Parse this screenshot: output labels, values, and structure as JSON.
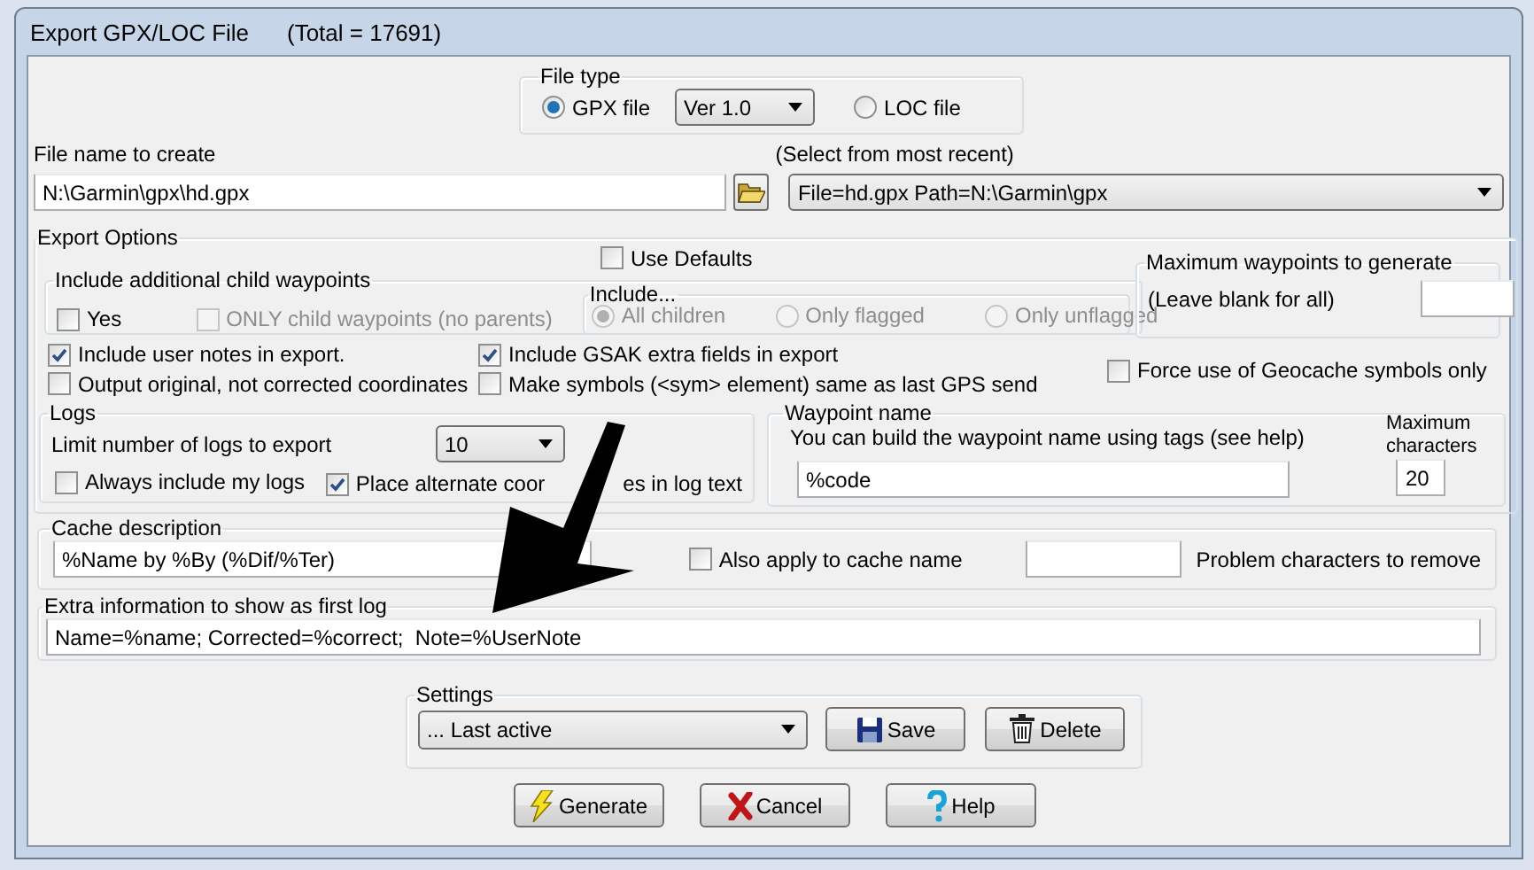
{
  "window": {
    "title": "Export GPX/LOC File",
    "total": "(Total = 17691)"
  },
  "file_type": {
    "label": "File type",
    "version": "Ver 1.0",
    "options": [
      {
        "label": "GPX file",
        "selected": true
      },
      {
        "label": "LOC file",
        "selected": false
      }
    ]
  },
  "file_name": {
    "label": "File name to create",
    "value": "N:\\Garmin\\gpx\\hd.gpx"
  },
  "recent": {
    "label": "(Select from most recent)",
    "value": "File=hd.gpx Path=N:\\Garmin\\gpx"
  },
  "export_options": {
    "label": "Export Options",
    "use_defaults": {
      "label": "Use Defaults",
      "checked": false
    },
    "child_waypoints": {
      "label": "Include additional child waypoints",
      "yes": {
        "label": "Yes",
        "checked": false,
        "disabled": false
      },
      "only_child": {
        "label": "ONLY child waypoints (no parents)",
        "checked": false,
        "disabled": true
      },
      "include": {
        "label": "Include...",
        "disabled": true,
        "options": [
          {
            "label": "All children",
            "selected": true
          },
          {
            "label": "Only flagged",
            "selected": false
          },
          {
            "label": "Only unflagged",
            "selected": false
          }
        ]
      }
    },
    "max_waypoints": {
      "label": "Maximum waypoints to generate",
      "hint": "(Leave blank for all)"
    },
    "left_checks": [
      {
        "label": "Include user notes in export.",
        "checked": true
      },
      {
        "label": "Output original, not corrected coordinates",
        "checked": false
      }
    ],
    "right_checks": [
      {
        "label": "Include GSAK extra fields in export",
        "checked": true
      },
      {
        "label": "Make symbols (<sym> element) same as last GPS send",
        "checked": false
      }
    ],
    "force_symbols": {
      "label": "Force use of Geocache symbols only",
      "checked": false
    },
    "logs": {
      "label": "Logs",
      "limit_label": "Limit number of logs to export",
      "limit": "10",
      "always_mine": {
        "label": "Always include my logs",
        "checked": false
      },
      "alternate_coords": {
        "label": "Place alternate coor",
        "label_after": "es in log text",
        "checked": true
      }
    },
    "waypoint_name": {
      "label": "Waypoint name",
      "hint": "You can build the waypoint name using tags (see help)",
      "value": "%code",
      "max_label": "Maximum characters",
      "max": "20"
    }
  },
  "cache_description": {
    "label": "Cache description",
    "value": "%Name by %By (%Dif/%Ter)",
    "apply_to_name": {
      "label": "Also apply to cache name",
      "checked": false
    },
    "problem_label": "Problem characters to remove"
  },
  "extra_info": {
    "label": "Extra information to show as first log",
    "value": "Name=%name; Corrected=%correct;  Note=%UserNote"
  },
  "settings": {
    "label": "Settings",
    "value": "... Last active",
    "buttons": [
      {
        "kind": "save",
        "label": "Save"
      },
      {
        "kind": "delete",
        "label": "Delete"
      }
    ]
  },
  "buttons": [
    {
      "kind": "generate",
      "label": "Generate"
    },
    {
      "kind": "cancel",
      "label": "Cancel"
    },
    {
      "kind": "help",
      "label": "Help"
    }
  ]
}
